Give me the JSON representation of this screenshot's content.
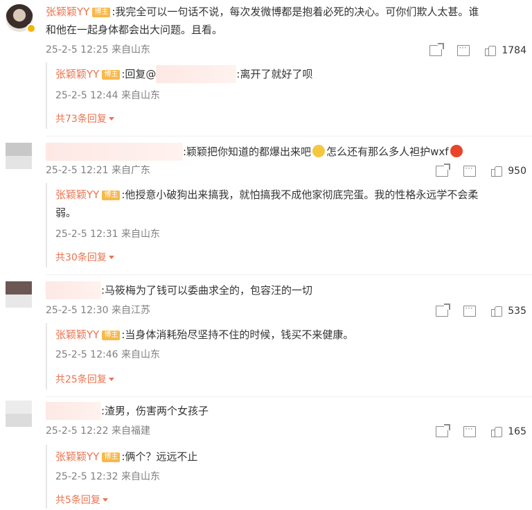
{
  "comments": [
    {
      "author": "张颖颖YY",
      "badge": "博主",
      "text": ":我完全可以一句话不说，每次发微博都是抱着必死的决心。可你们欺人太甚。谁",
      "text2": "和他在一起身体都会出大问题。且看。",
      "time": "25-2-5 12:25 来自山东",
      "likes": "1784",
      "reply": {
        "author": "张颖颖YY",
        "badge": "博主",
        "prefix": ":回复@",
        "suffix": ":离开了就好了呗",
        "time": "25-2-5 12:44 来自山东"
      },
      "more_replies": "共73条回复"
    },
    {
      "text_a": ":颖颖把你知道的都爆出来吧",
      "text_b": "怎么还有那么多人袒护wxf",
      "time": "25-2-5 12:21 来自广东",
      "likes": "950",
      "reply": {
        "author": "张颖颖YY",
        "badge": "博主",
        "text": ":他授意小破狗出来搞我，就怕搞我不成他家彻底完蛋。我的性格永远学不会柔",
        "text2": "弱。",
        "time": "25-2-5 12:31 来自山东"
      },
      "more_replies": "共30条回复"
    },
    {
      "text": ":马筱梅为了钱可以委曲求全的，包容汪的一切",
      "time": "25-2-5 12:30 来自江苏",
      "likes": "535",
      "reply": {
        "author": "张颖颖YY",
        "badge": "博主",
        "text": ":当身体消耗殆尽坚持不住的时候，钱买不来健康。",
        "time": "25-2-5 12:46 来自山东"
      },
      "more_replies": "共25条回复"
    },
    {
      "text": ":渣男，伤害两个女孩子",
      "time": "25-2-5 12:22 来自福建",
      "likes": "165",
      "reply": {
        "author": "张颖颖YY",
        "badge": "博主",
        "text": ":俩个？远远不止",
        "time": "25-2-5 12:32 来自山东"
      },
      "more_replies": "共5条回复"
    }
  ],
  "icons": {
    "share": "share-icon",
    "comment": "comment-icon",
    "like": "thumbs-up-icon",
    "emoji_cry": "crying-face-emoji",
    "emoji_angry": "angry-face-emoji",
    "caret": "caret-down-icon"
  },
  "colors": {
    "author": "#eb7350",
    "badge": "#f7b94c",
    "meta": "#808080",
    "reply_border": "#e6e6e6"
  }
}
